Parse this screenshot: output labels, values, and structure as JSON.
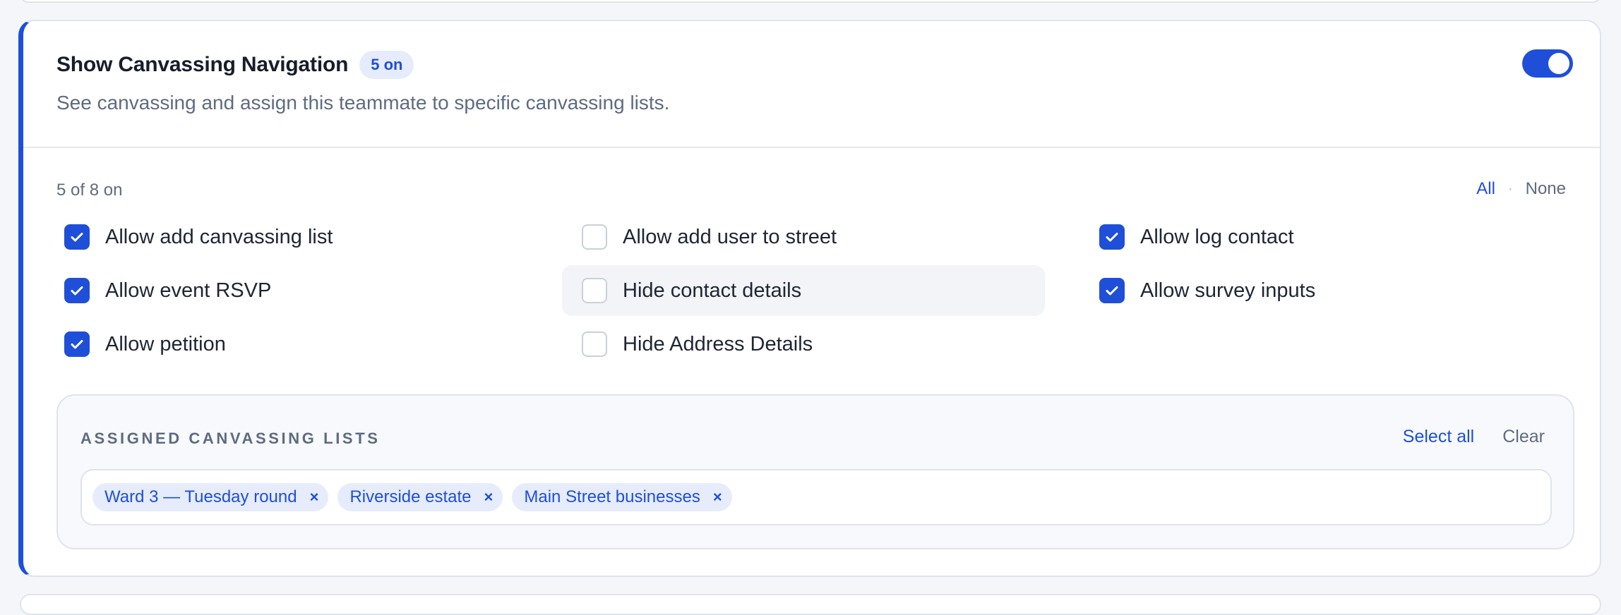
{
  "section": {
    "title": "Show Canvassing Navigation",
    "badge": "5 on",
    "description": "See canvassing and assign this teammate to specific canvassing lists.",
    "enabled": true
  },
  "permissions": {
    "count_text": "5 of 8 on",
    "all_label": "All",
    "separator": "·",
    "none_label": "None",
    "items": [
      {
        "label": "Allow add canvassing list",
        "checked": true
      },
      {
        "label": "Allow add user to street",
        "checked": false
      },
      {
        "label": "Allow log contact",
        "checked": true
      },
      {
        "label": "Allow event RSVP",
        "checked": true
      },
      {
        "label": "Hide contact details",
        "checked": false
      },
      {
        "label": "Allow survey inputs",
        "checked": true
      },
      {
        "label": "Allow petition",
        "checked": true
      },
      {
        "label": "Hide Address Details",
        "checked": false
      }
    ]
  },
  "assigned_lists": {
    "heading": "ASSIGNED CANVASSING LISTS",
    "select_all_label": "Select all",
    "clear_label": "Clear",
    "remove_glyph": "×",
    "chips": [
      "Ward 3 — Tuesday round",
      "Riverside estate",
      "Main Street businesses"
    ]
  },
  "colors": {
    "accent": "#1f4fd8",
    "muted_text": "#5f6b80",
    "border": "#dfe4ec"
  }
}
